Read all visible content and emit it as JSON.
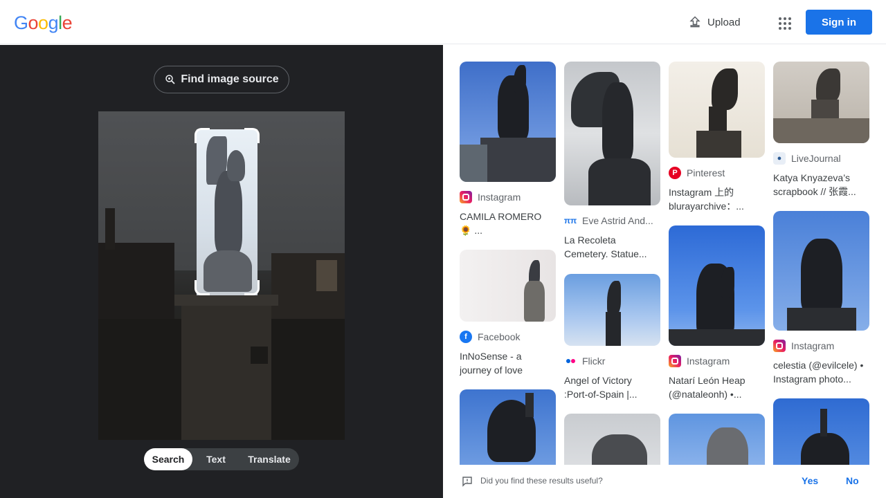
{
  "header": {
    "logo_letters": [
      {
        "ch": "G",
        "color": "#4285F4"
      },
      {
        "ch": "o",
        "color": "#EA4335"
      },
      {
        "ch": "o",
        "color": "#FBBC05"
      },
      {
        "ch": "g",
        "color": "#4285F4"
      },
      {
        "ch": "l",
        "color": "#34A853"
      },
      {
        "ch": "e",
        "color": "#EA4335"
      }
    ],
    "upload_label": "Upload",
    "upload_icon": "upload-icon",
    "apps_icon": "apps-grid-icon",
    "signin_label": "Sign in"
  },
  "left": {
    "find_source_label": "Find image source",
    "find_source_icon": "lens-search-icon",
    "tabs": [
      {
        "label": "Search",
        "active": true
      },
      {
        "label": "Text",
        "active": false
      },
      {
        "label": "Translate",
        "active": false
      }
    ]
  },
  "results": [
    {
      "col": 0,
      "source": "Instagram",
      "title": "CAMILA ROMERO 🌻 ...",
      "icon": "instagram-icon"
    },
    {
      "col": 0,
      "source": "Facebook",
      "title": "InNoSense - a journey of love",
      "icon": "facebook-icon"
    },
    {
      "col": 0,
      "source": "",
      "title": "",
      "icon": ""
    },
    {
      "col": 1,
      "source": "Eve Astrid And...",
      "title": "La Recoleta Cemetery. Statue...",
      "icon": "pi-pi-icon"
    },
    {
      "col": 1,
      "source": "Flickr",
      "title": "Angel of Victory :Port-of-Spain |...",
      "icon": "flickr-icon"
    },
    {
      "col": 1,
      "source": "",
      "title": "",
      "icon": ""
    },
    {
      "col": 2,
      "source": "Pinterest",
      "title": "Instagram 上的 blurayarchive：...",
      "icon": "pinterest-icon"
    },
    {
      "col": 2,
      "source": "Instagram",
      "title": "Natarí León Heap (@nataleonh) •...",
      "icon": "instagram-icon"
    },
    {
      "col": 2,
      "source": "",
      "title": "",
      "icon": ""
    },
    {
      "col": 3,
      "source": "LiveJournal",
      "title": "Katya Knyazeva’s scrapbook // 张霞...",
      "icon": "livejournal-icon"
    },
    {
      "col": 3,
      "source": "Instagram",
      "title": "celestia (@evilcele) • Instagram photo...",
      "icon": "instagram-icon"
    },
    {
      "col": 3,
      "source": "",
      "title": "",
      "icon": ""
    }
  ],
  "feedback": {
    "question": "Did you find these results useful?",
    "yes": "Yes",
    "no": "No",
    "icon": "feedback-icon"
  },
  "colors": {
    "accent": "#1a73e8",
    "dark_panel": "#202124"
  }
}
